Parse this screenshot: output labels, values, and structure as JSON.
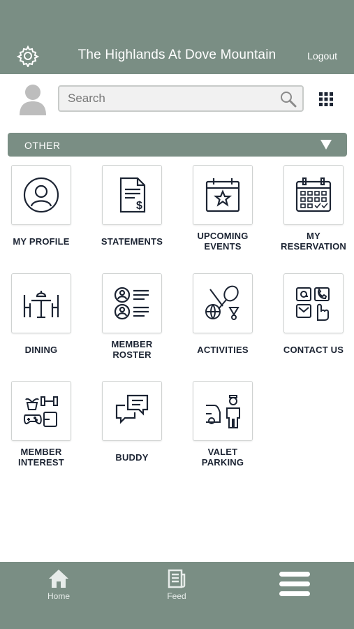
{
  "header": {
    "title": "The Highlands At Dove Mountain",
    "logout_label": "Logout"
  },
  "search": {
    "placeholder": "Search",
    "value": ""
  },
  "section": {
    "label": "OTHER"
  },
  "tiles": [
    {
      "label": "MY PROFILE",
      "icon": "profile-icon"
    },
    {
      "label": "STATEMENTS",
      "icon": "statement-icon"
    },
    {
      "label": "UPCOMING\nEVENTS",
      "icon": "calendar-star-icon"
    },
    {
      "label": "MY\nRESERVATION",
      "icon": "reservation-calendar-icon"
    },
    {
      "label": "DINING",
      "icon": "dining-table-icon"
    },
    {
      "label": "MEMBER\nROSTER",
      "icon": "roster-icon"
    },
    {
      "label": "ACTIVITIES",
      "icon": "sports-icon"
    },
    {
      "label": "CONTACT US",
      "icon": "contact-icon"
    },
    {
      "label": "MEMBER\nINTEREST",
      "icon": "interests-icon"
    },
    {
      "label": "BUDDY",
      "icon": "chat-bubbles-icon"
    },
    {
      "label": "VALET\nPARKING",
      "icon": "valet-icon"
    }
  ],
  "bottom_nav": [
    {
      "label": "Home",
      "icon": "home-icon"
    },
    {
      "label": "Feed",
      "icon": "feed-icon"
    },
    {
      "label": "",
      "icon": "hamburger-menu-icon"
    }
  ],
  "colors": {
    "primary": "#7a8e84",
    "icon_stroke": "#1c2433"
  }
}
